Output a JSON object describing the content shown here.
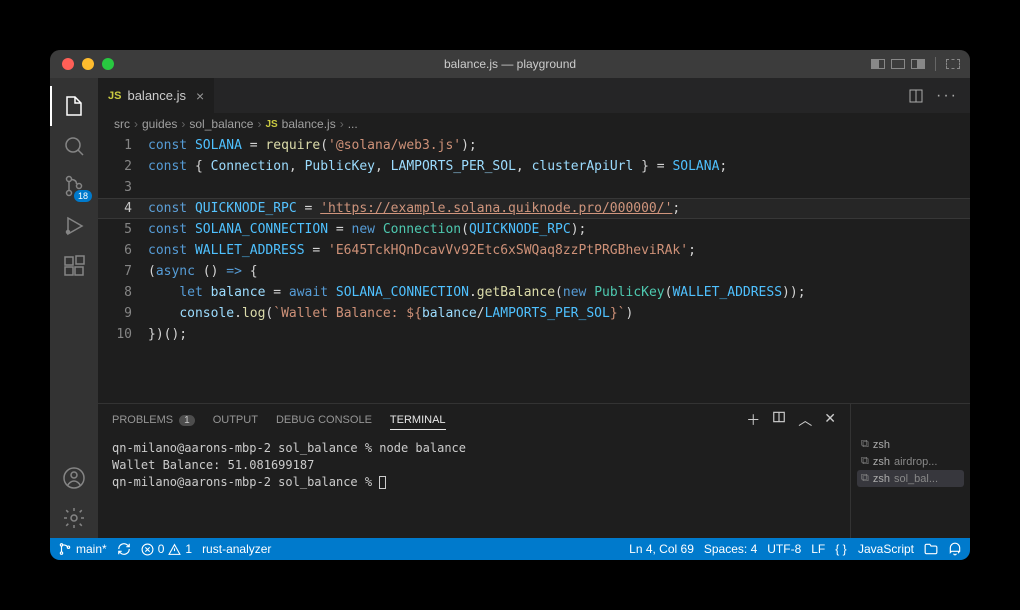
{
  "window_title": "balance.js — playground",
  "activity_badge": "18",
  "tab": {
    "icon": "JS",
    "name": "balance.js"
  },
  "breadcrumb": [
    "src",
    "guides",
    "sol_balance",
    "balance.js",
    "..."
  ],
  "code_lines": [
    "1",
    "2",
    "3",
    "4",
    "5",
    "6",
    "7",
    "8",
    "9",
    "10"
  ],
  "code": {
    "solana_var": "SOLANA",
    "require_fn": "require",
    "require_arg": "'@solana/web3.js'",
    "conn": "Connection",
    "pubkey": "PublicKey",
    "lps": "LAMPORTS_PER_SOL",
    "cau": "clusterApiUrl",
    "rpc_var": "QUICKNODE_RPC",
    "rpc_val": "'https://example.solana.quiknode.pro/000000/'",
    "soconn": "SOLANA_CONNECTION",
    "new_kw": "new",
    "wallet_var": "WALLET_ADDRESS",
    "wallet_val": "'E645TckHQnDcavVv92Etc6xSWQaq8zzPtPRGBheviRAk'",
    "async": "async",
    "let": "let",
    "balance": "balance",
    "await": "await",
    "getbal": "getBalance",
    "console": "console",
    "log": "log",
    "template_pre": "`Wallet Balance: ${",
    "template_post": "}`",
    "const": "const"
  },
  "panel_tabs": {
    "problems": "PROBLEMS",
    "problems_count": "1",
    "output": "OUTPUT",
    "debug": "DEBUG CONSOLE",
    "terminal": "TERMINAL"
  },
  "terminal_lines": [
    "qn-milano@aarons-mbp-2 sol_balance % node balance",
    "Wallet Balance: 51.081699187",
    "qn-milano@aarons-mbp-2 sol_balance % "
  ],
  "terminal_list": [
    {
      "shell": "zsh",
      "label": ""
    },
    {
      "shell": "zsh",
      "label": "airdrop..."
    },
    {
      "shell": "zsh",
      "label": "sol_bal..."
    }
  ],
  "status": {
    "branch": "main*",
    "sync": "",
    "errors": "0",
    "warnings": "1",
    "ext": "rust-analyzer",
    "pos": "Ln 4, Col 69",
    "spaces": "Spaces: 4",
    "enc": "UTF-8",
    "eol": "LF",
    "lang_icon": "{ }",
    "lang": "JavaScript"
  }
}
